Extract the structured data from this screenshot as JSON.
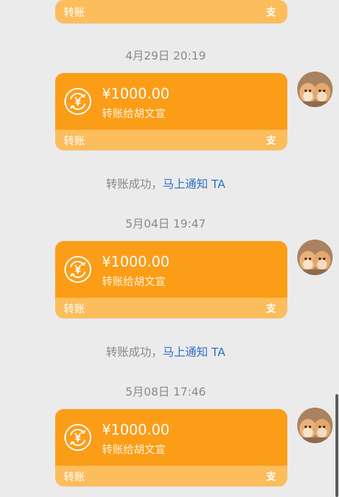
{
  "partial_card": {
    "footer_label": "转账",
    "brand_glyph": "支"
  },
  "events": [
    {
      "timestamp": "4月29日 20:19",
      "amount": "¥1000.00",
      "recipient": "转账给胡文宣",
      "footer_label": "转账",
      "brand_glyph": "支",
      "notice_prefix": "转账成功，",
      "notice_link": "马上通知 TA"
    },
    {
      "timestamp": "5月04日 19:47",
      "amount": "¥1000.00",
      "recipient": "转账给胡文宣",
      "footer_label": "转账",
      "brand_glyph": "支",
      "notice_prefix": "转账成功，",
      "notice_link": "马上通知 TA"
    },
    {
      "timestamp": "5月08日 17:46",
      "amount": "¥1000.00",
      "recipient": "转账给胡文宣",
      "footer_label": "转账",
      "brand_glyph": "支"
    }
  ],
  "colors": {
    "card_orange": "#fb9d17",
    "card_footer": "#fcbd5d",
    "link_blue": "#2f6fc7",
    "background": "#ebebeb"
  },
  "icons": {
    "transfer": "transfer-cycle-icon",
    "brand": "alipay-zhi-glyph"
  }
}
